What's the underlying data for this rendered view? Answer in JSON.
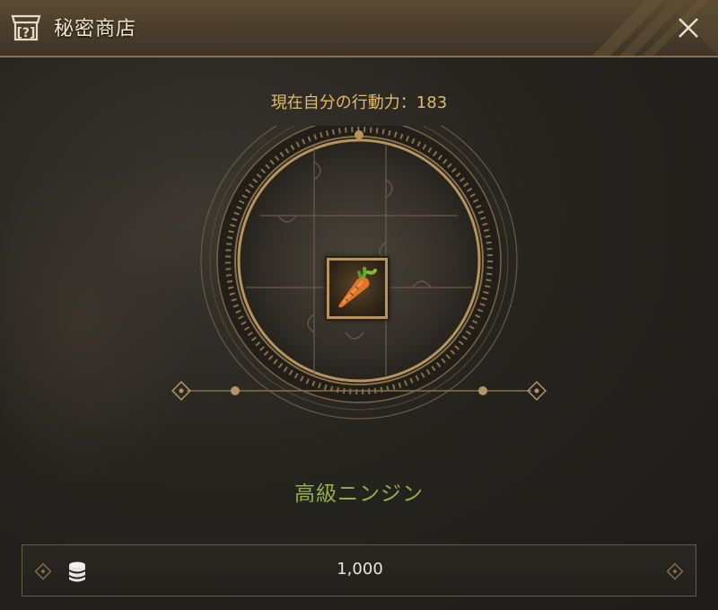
{
  "window": {
    "title": "秘密商店"
  },
  "icons": {
    "shop": "shop-icon",
    "close": "close-icon",
    "coin": "coin-stack-icon",
    "item": "carrot-icon"
  },
  "status": {
    "energy_text": "現在自分の行動力：183"
  },
  "item": {
    "name": "高級ニンジン"
  },
  "price": {
    "value": "1,000"
  },
  "colors": {
    "accent_gold": "#e2b964",
    "item_name_green": "#8fb04a",
    "frame_gold": "#b59460"
  }
}
